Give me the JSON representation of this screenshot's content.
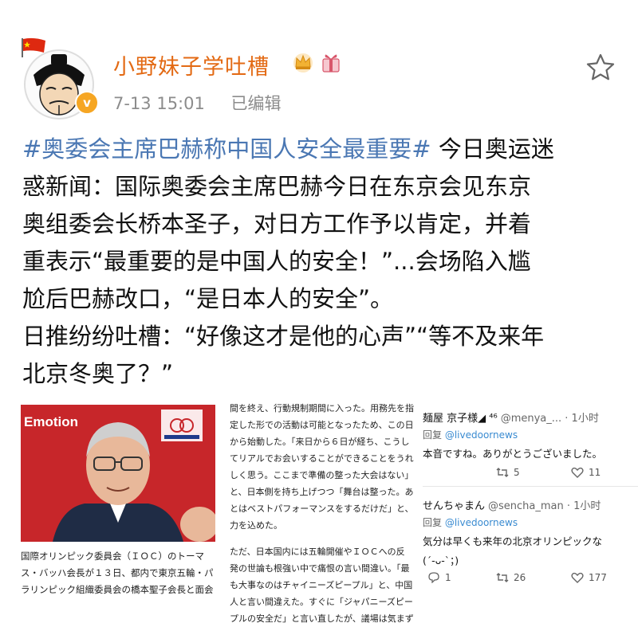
{
  "header": {
    "username": "小野妹子学吐槽",
    "time": "7-13 15:01",
    "edited": "已编辑"
  },
  "post": {
    "hashtag": "#奥委会主席巴赫称中国人安全最重要#",
    "line1_rest": " 今日奥运迷",
    "line2": "惑新闻：国际奥委会主席巴赫今日在东京会见东京",
    "line3": "奥组委会长桥本圣子，对日方工作予以肯定，并着",
    "line4": "重表示“最重要的是中国人的安全！”...会场陷入尴",
    "line5": "尬后巴赫改口，“是日本人的安全”。",
    "line6": "日推纷纷吐槽：“好像这才是他的心声”“等不及来年",
    "line7": "北京冬奥了？”"
  },
  "clipping": {
    "photo_text": "Emotion",
    "caption": [
      "国際オリンピック委員会（ＩＯＣ）のトーマ",
      "ス・バッハ会長が１３日、都内で東京五輪・パ",
      "ラリンピック組織委員会の橋本聖子会長と面会"
    ],
    "article_p1": [
      "間を終え、行動規制期間に入った。用務先を指",
      "定した形での活動は可能となったため、この日",
      "から始動した。「来日から６日が経ち、こうし",
      "てリアルでお会いすることができることをうれ",
      "しく思う。ここまで準備の整った大会はない」",
      "と、日本側を持ち上げつつ「舞台は整った。あ",
      "とはベストパフォーマンスをするだけだ」と、",
      "力を込めた。"
    ],
    "article_p2": [
      "ただ、日本国内には五輪開催やＩＯＣへの反",
      "発の世論も根強い中で痛恨の言い間違い。「最",
      "も大事なのはチャイニーズピープル」と、中国",
      "人と言い間違えた。すぐに「ジャパニーズピー",
      "プルの安全だ」と言い直したが、議場は気まず"
    ]
  },
  "tweets": [
    {
      "user": "麺屋 京子様◢ ⁴⁶",
      "handle": "@menya_... · 1小时",
      "reply_prefix": "回复",
      "reply_to": "@livedoornews",
      "text": "本音ですね。ありがとうございました。",
      "retweets": "5",
      "likes": "11"
    },
    {
      "user": "せんちゃまん",
      "handle": "@sencha_man · 1小时",
      "reply_prefix": "回复",
      "reply_to": "@livedoornews",
      "text": "気分は早くも来年の北京オリンピックな",
      "text2": "(´-ᴗ-`；)",
      "replies": "1",
      "retweets": "26",
      "likes": "177"
    }
  ],
  "colors": {
    "username": "#e36a14",
    "hashtag": "#4a77b3",
    "meta": "#8c8c8c"
  }
}
